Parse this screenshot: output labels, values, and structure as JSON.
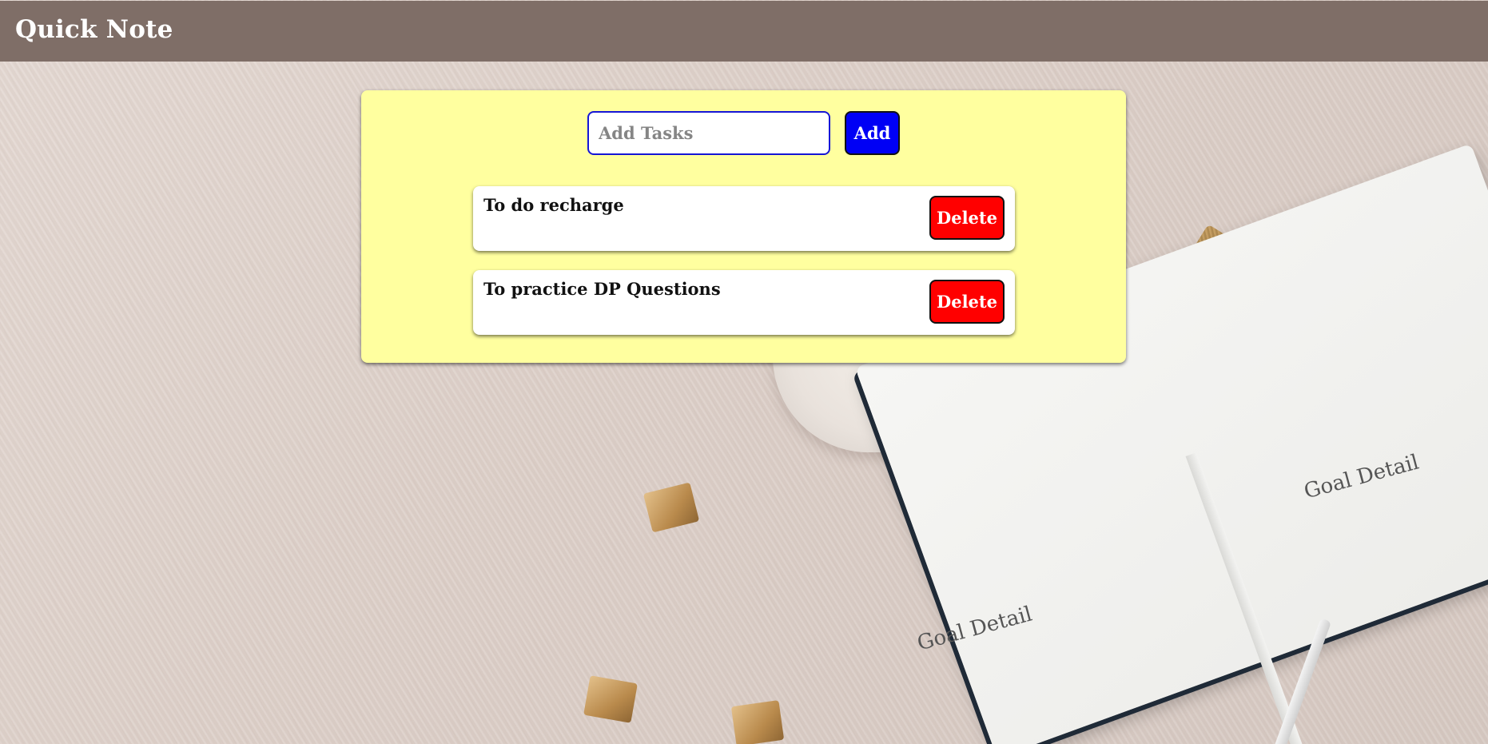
{
  "app": {
    "title": "Quick Note"
  },
  "add_form": {
    "input_placeholder": "Add Tasks",
    "input_value": "",
    "add_label": "Add"
  },
  "tasks": [
    {
      "text": "To do recharge",
      "delete_label": "Delete"
    },
    {
      "text": "To practice DP Questions",
      "delete_label": "Delete"
    }
  ],
  "background": {
    "notebook_heading": "Goal Detail"
  },
  "colors": {
    "header": "#7f6e67",
    "card": "#ffff9f",
    "add_button": "#0000f5",
    "delete_button": "#ff0000",
    "input_border": "#1515d6"
  }
}
